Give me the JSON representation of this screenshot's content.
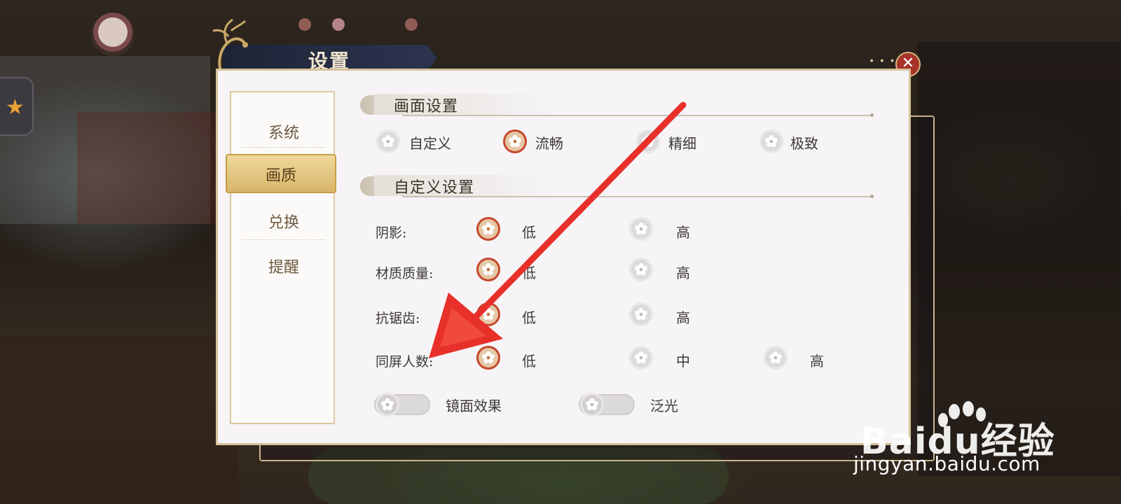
{
  "window": {
    "title": "设置"
  },
  "sidebar": {
    "items": [
      {
        "label": "系统",
        "active": false
      },
      {
        "label": "画质",
        "active": true
      },
      {
        "label": "兑换",
        "active": false
      },
      {
        "label": "提醒",
        "active": false
      }
    ]
  },
  "graphics": {
    "section_title": "画面设置",
    "presets": [
      {
        "label": "自定义",
        "selected": false
      },
      {
        "label": "流畅",
        "selected": true
      },
      {
        "label": "精细",
        "selected": false
      },
      {
        "label": "极致",
        "selected": false
      }
    ]
  },
  "custom": {
    "section_title": "自定义设置",
    "rows": [
      {
        "label": "阴影:",
        "options": [
          {
            "label": "低",
            "selected": true
          },
          {
            "label": "高",
            "selected": false
          }
        ]
      },
      {
        "label": "材质质量:",
        "options": [
          {
            "label": "低",
            "selected": true
          },
          {
            "label": "高",
            "selected": false
          }
        ]
      },
      {
        "label": "抗锯齿:",
        "options": [
          {
            "label": "低",
            "selected": true
          },
          {
            "label": "高",
            "selected": false
          }
        ]
      },
      {
        "label": "同屏人数:",
        "options": [
          {
            "label": "低",
            "selected": true
          },
          {
            "label": "中",
            "selected": false
          },
          {
            "label": "高",
            "selected": false
          }
        ]
      }
    ],
    "toggles": [
      {
        "label": "镜面效果",
        "on": false
      },
      {
        "label": "泛光",
        "on": false
      }
    ]
  },
  "watermark": {
    "brand": "Baidu经验",
    "url": "jingyan.baidu.com"
  },
  "colors": {
    "accent_red": "#e8302a",
    "panel_bg": "#f6f4f7",
    "gold": "#d7c39a",
    "title_bar": "#1e2436"
  }
}
